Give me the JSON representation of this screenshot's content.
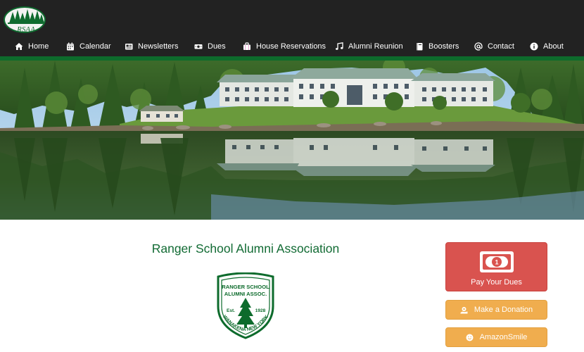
{
  "logo": {
    "text": "RSAA"
  },
  "nav": {
    "items": [
      {
        "label": "Home",
        "icon": "home-icon"
      },
      {
        "label": "Calendar",
        "icon": "calendar-icon"
      },
      {
        "label": "Newsletters",
        "icon": "newspaper-icon"
      },
      {
        "label": "Dues",
        "icon": "money-icon"
      },
      {
        "label": "House Reservations",
        "icon": "suitcase-icon"
      },
      {
        "label": "Alumni Reunion",
        "icon": "music-icon"
      },
      {
        "label": "Boosters",
        "icon": "book-icon"
      },
      {
        "label": "Contact",
        "icon": "at-icon"
      },
      {
        "label": "About",
        "icon": "info-icon"
      }
    ]
  },
  "hero": {
    "image": "campus-lake-reflection"
  },
  "main": {
    "title": "Ranger School Alumni Association",
    "badge": {
      "line1": "RANGER SCHOOL",
      "line2": "ALUMNI ASSOC.",
      "est": "Est.",
      "year": "1928",
      "location": "WANAKENA NEW YORK"
    }
  },
  "sidebar": {
    "dues_label": "Pay Your Dues",
    "donation_label": "Make a Donation",
    "amazon_label": "AmazonSmile"
  },
  "colors": {
    "topbar": "#222222",
    "brand_green": "#0d6b2c",
    "danger": "#d9534f",
    "warning": "#f0ad4e"
  }
}
